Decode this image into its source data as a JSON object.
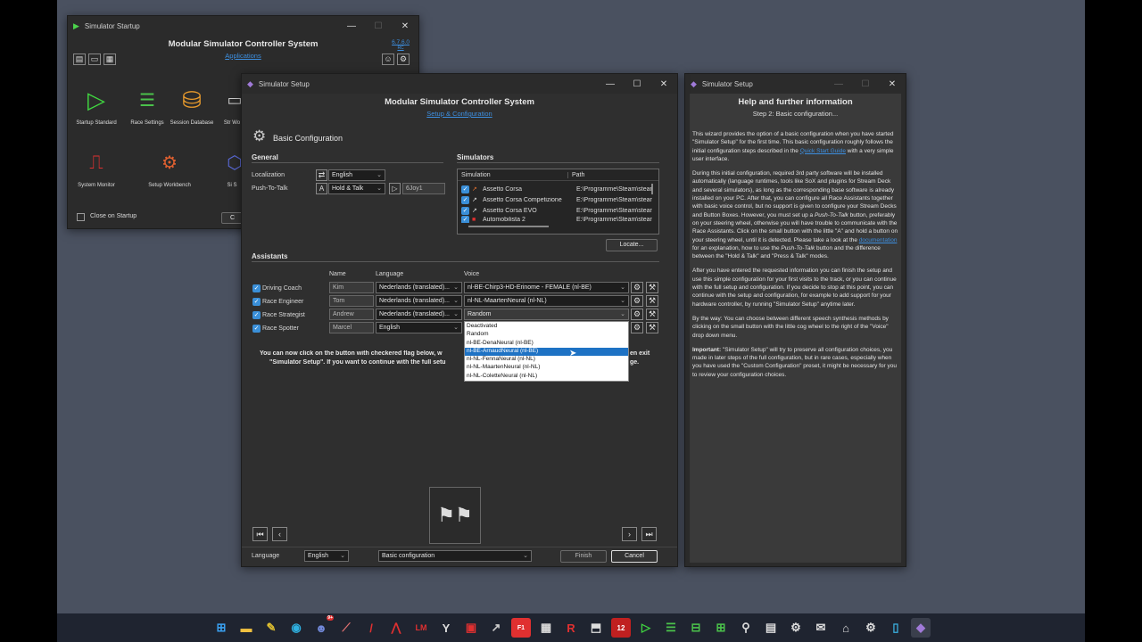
{
  "startup": {
    "title": "Simulator Startup",
    "heading": "Modular Simulator Controller System",
    "version": "6.7.6.0",
    "version_sub": "RC",
    "link": "Applications",
    "close_on_startup": "Close on Startup",
    "close_btn": "C",
    "apps": [
      {
        "label": "Startup Standard",
        "icon": "play-icon"
      },
      {
        "label": "Race Settings",
        "icon": "car-settings-icon"
      },
      {
        "label": "Session Database",
        "icon": "database-icon"
      },
      {
        "label": "Str Wo",
        "icon": "monitor-icon"
      },
      {
        "label": "System Monitor",
        "icon": "system-monitor-icon"
      },
      {
        "label": "Setup Workbench",
        "icon": "wrench-car-icon"
      },
      {
        "label": "Si S",
        "icon": "hexagon-icon"
      }
    ]
  },
  "setup": {
    "title": "Simulator Setup",
    "heading": "Modular Simulator Controller System",
    "link": "Setup & Configuration",
    "section_title": "Basic Configuration",
    "general": {
      "label": "General",
      "localization_label": "Localization",
      "localization": "English",
      "ptt_label": "Push-To-Talk",
      "ptt": "Hold & Talk",
      "ptt_button": "6Joy1"
    },
    "simulators": {
      "label": "Simulators",
      "col_sim": "Simulation",
      "col_path": "Path",
      "rows": [
        {
          "name": "Assetto Corsa",
          "path": "E:\\Programme\\Steam\\stear"
        },
        {
          "name": "Assetto Corsa Competizione",
          "path": "E:\\Programme\\Steam\\stear"
        },
        {
          "name": "Assetto Corsa EVO",
          "path": "E:\\Programme\\Steam\\stear"
        },
        {
          "name": "Automobilista 2",
          "path": "E:\\Programme\\Steam\\stear"
        }
      ],
      "locate": "Locate..."
    },
    "assistants": {
      "label": "Assistants",
      "col_name": "Name",
      "col_lang": "Language",
      "col_voice": "Voice",
      "rows": [
        {
          "role": "Driving Coach",
          "name": "Kim",
          "language": "Nederlands (translated)...",
          "voice": "nl-BE-Chirp3-HD-Erinome - FEMALE (nl-BE)"
        },
        {
          "role": "Race Engineer",
          "name": "Tom",
          "language": "Nederlands (translated)...",
          "voice": "nl-NL-MaartenNeural (nl-NL)"
        },
        {
          "role": "Race Strategist",
          "name": "Andrew",
          "language": "Nederlands (translated)...",
          "voice": "Random"
        },
        {
          "role": "Race Spotter",
          "name": "Marcel",
          "language": "English",
          "voice": ""
        }
      ]
    },
    "voice_options": [
      "Deactivated",
      "Random",
      "nl-BE-DenaNeural (nl-BE)",
      "nl-BE-ArnaudNeural (nl-BE)",
      "nl-NL-FennaNeural (nl-NL)",
      "nl-NL-MaartenNeural (nl-NL)",
      "nl-NL-ColetteNeural (nl-NL)"
    ],
    "info_line1": "You can now click on the button with checkered flag below, w",
    "info_line1b": "en exit",
    "info_line2": "\"Simulator Setup\". If you want to continue with the full setu",
    "info_line2b": "ge.",
    "footer": {
      "language_label": "Language",
      "language": "English",
      "preset": "Basic configuration",
      "finish": "Finish",
      "cancel": "Cancel"
    }
  },
  "help": {
    "title": "Simulator Setup",
    "heading": "Help and further information",
    "step": "Step 2: Basic configuration...",
    "p1a": "This wizard provides the option of a basic configuration when you have started \"Simulator Setup\" for the first time. This basic configuration roughly follows the initial configuration steps described in the ",
    "p1link": "Quick Start Guide",
    "p1b": " with a very simple user interface.",
    "p2a": "During this initial configuration, required 3rd party software will be installed automatically (language runtimes, tools like SoX and plugins for Stream Deck and several simulators), as long as the corresponding base software is already installed on your PC. After that, you can configure all Race Assistants together with basic voice control, but no support is given to configure your Stream Decks and Button Boxes. However, you must set up a ",
    "p2em": "Push-To-Talk",
    "p2b": " button, preferably on your steering wheel, otherwise you will have trouble to communicate with the Race Assistants. Click on the small button with the little \"A\" and hold a button on your steering wheel, until it is detected. Please take a look at the ",
    "p2link": "documentation",
    "p2c": " for an explanation, how to use the ",
    "p2em2": "Push-To-Talk",
    "p2d": " button and the difference between the \"Hold & Talk\" and \"Press & Talk\" modes.",
    "p3": "After you have entered the requested information you can finish the setup and use this simple configuration for your first visits to the track, or you can continue with the full setup and configuration. If you decide to stop at this point, you can continue with the setup and configuration, for example to add support for your hardware controller, by running \"Simulator Setup\" anytime later.",
    "p4": "By the way: You can choose between different speech synthesis methods by clicking on the small button with the little cog wheel to the right of the \"Voice\" drop down menu.",
    "p5b": "Important:",
    "p5": " \"Simulator Setup\" will try to preserve all configuration choices, you made in later steps of the full configuration, but in rare cases, especially when you have used the \"Custom Configuration\" preset, it might be necessary for you to review your configuration choices."
  },
  "taskbar": {
    "badge": "9+",
    "items": [
      "windows-icon",
      "file-explorer-icon",
      "app-icon",
      "edge-icon",
      "discord-icon",
      "assetto-icon",
      "racing-icon",
      "ams-icon",
      "lmu-icon",
      "iracing-icon",
      "app-icon",
      "app-icon",
      "f1-icon",
      "app-icon",
      "rfactor-icon",
      "app-icon",
      "12-icon",
      "startup-icon",
      "race-settings-icon",
      "app-icon",
      "app-icon",
      "app-icon",
      "app-icon",
      "app-icon",
      "app-icon",
      "app-icon",
      "setup-icon",
      "notes-icon",
      "active-app-icon"
    ]
  }
}
